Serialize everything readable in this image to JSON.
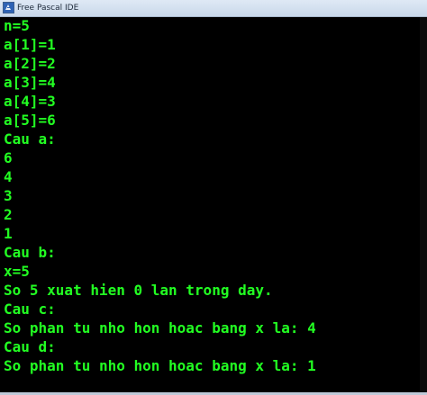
{
  "window": {
    "title": "Free Pascal IDE",
    "icon": "free-pascal-app-icon"
  },
  "console": {
    "text_color": "#22ff22",
    "background": "#000000",
    "lines": [
      "n=5",
      "a[1]=1",
      "a[2]=2",
      "a[3]=4",
      "a[4]=3",
      "a[5]=6",
      "Cau a:",
      "6",
      "4",
      "3",
      "2",
      "1",
      "Cau b:",
      "x=5",
      "So 5 xuat hien 0 lan trong day.",
      "Cau c:",
      "So phan tu nho hon hoac bang x la: 4",
      "Cau d:",
      "So phan tu nho hon hoac bang x la: 1"
    ]
  }
}
